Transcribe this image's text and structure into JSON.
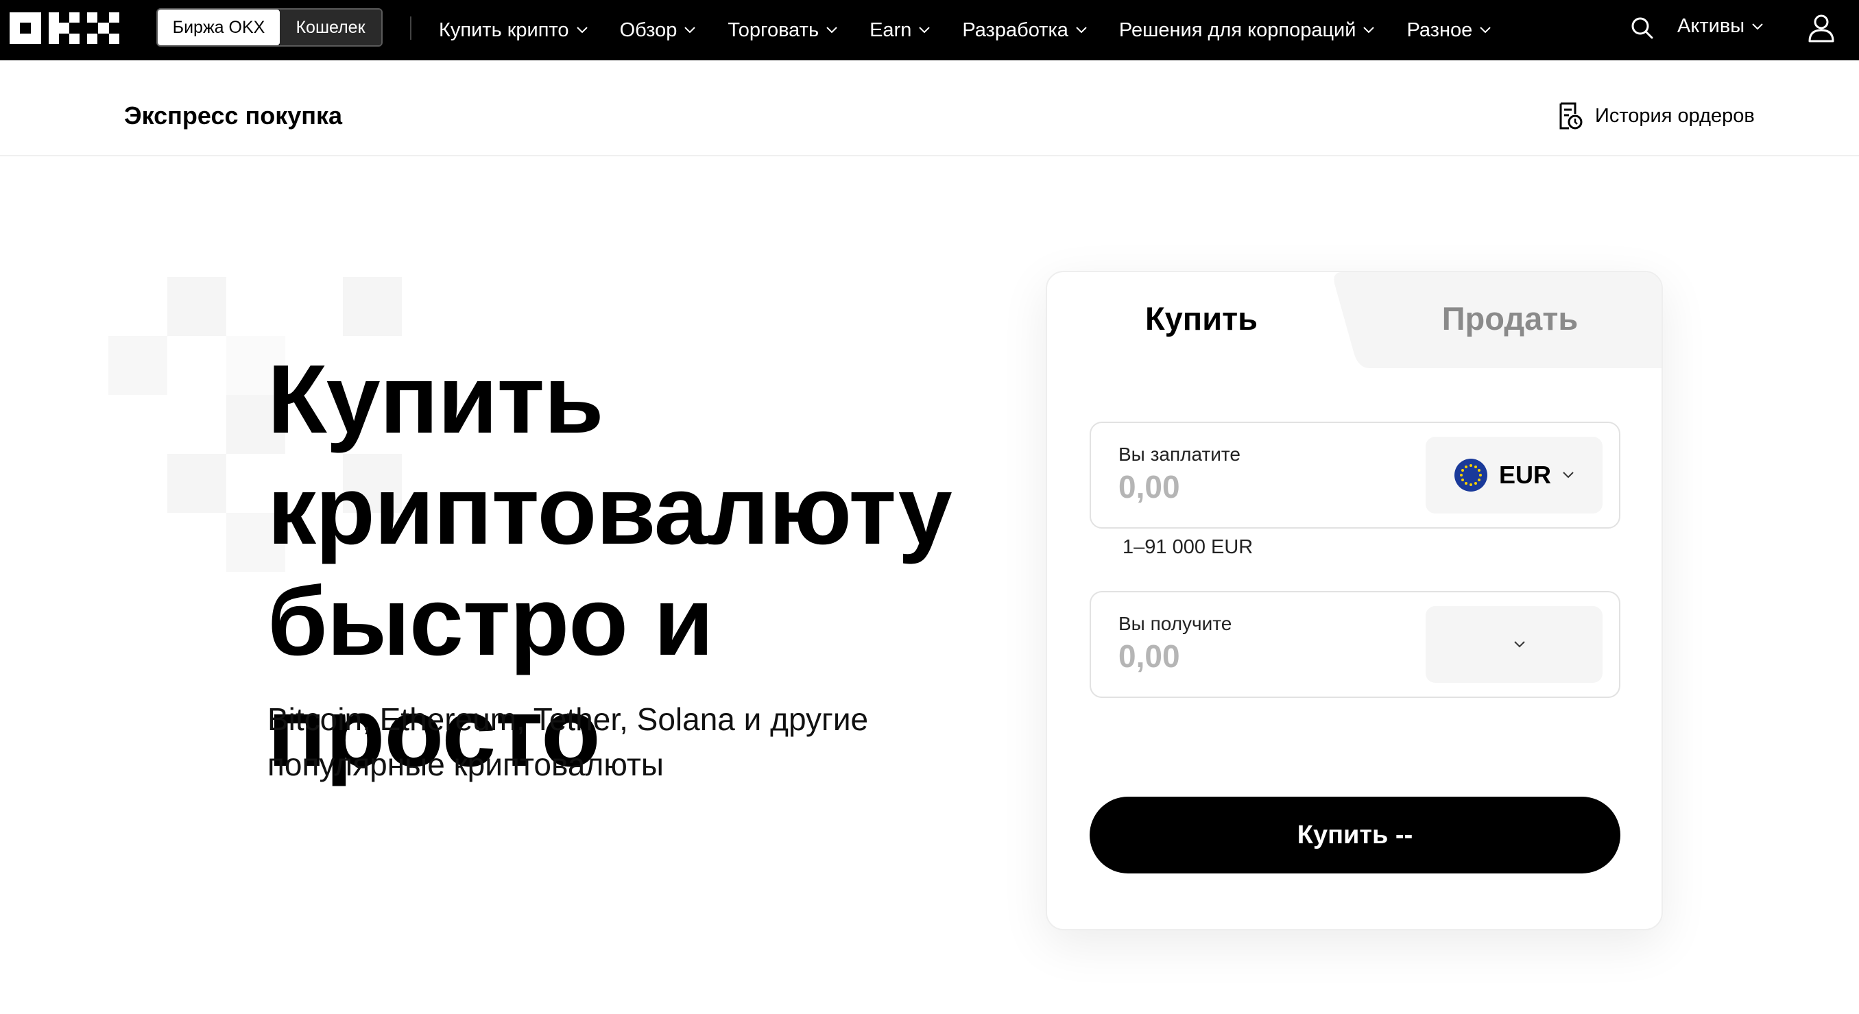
{
  "nav": {
    "switch": {
      "exchange": "Биржа OKX",
      "wallet": "Кошелек"
    },
    "items": [
      {
        "label": "Купить крипто"
      },
      {
        "label": "Обзор"
      },
      {
        "label": "Торговать"
      },
      {
        "label": "Earn"
      },
      {
        "label": "Разработка"
      },
      {
        "label": "Решения для корпораций"
      },
      {
        "label": "Разное"
      }
    ],
    "assets": "Активы",
    "icons": [
      "okx-logo",
      "search-icon",
      "chevron-down-icon",
      "user-icon"
    ]
  },
  "subheader": {
    "title": "Экспресс покупка",
    "history": "История ордеров"
  },
  "hero": {
    "title_lines": [
      "Купить",
      "криптовалюту",
      "быстро и просто"
    ],
    "subtitle_lines": [
      "Bitcoin, Ethereum, Tether, Solana и другие",
      "популярные криптовалюты"
    ]
  },
  "card": {
    "tabs": {
      "buy": "Купить",
      "sell": "Продать"
    },
    "pay": {
      "label": "Вы заплатите",
      "amount": "0,00",
      "currency": "EUR"
    },
    "range": "1–91 000 EUR",
    "receive": {
      "label": "Вы получите",
      "amount": "0,00",
      "currency": ""
    },
    "button": "Купить --"
  },
  "colors": {
    "nav_bg": "#000000",
    "accent": "#000000",
    "muted": "#b5b5b5",
    "flag": "#1a3a9a"
  }
}
